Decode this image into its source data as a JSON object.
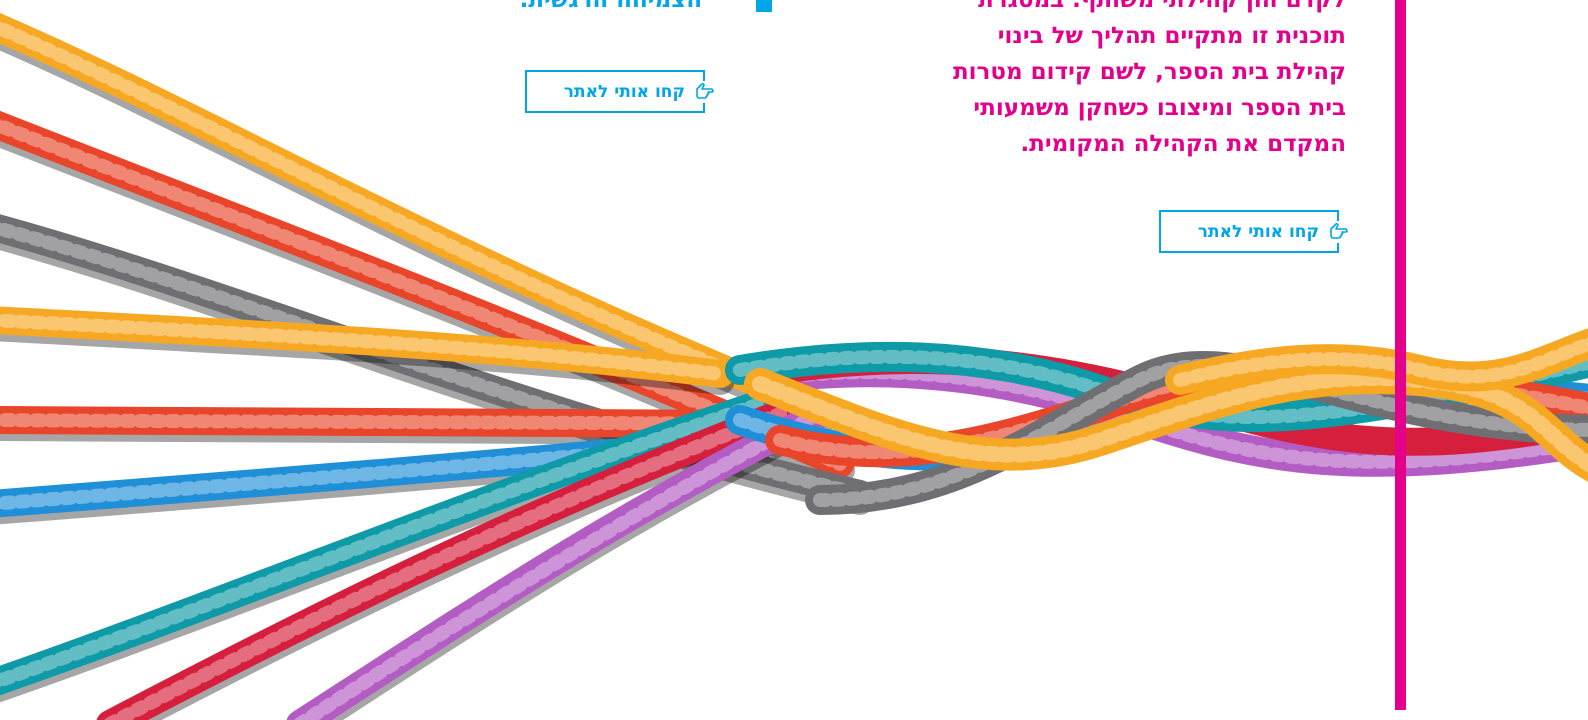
{
  "main": {
    "right_column": {
      "lines": [
        "לקדם הון קהילתי משותף. במסגרת",
        "תוכנית זו מתקיים תהליך של בינוי",
        "קהילת בית הספר, לשם קידום מטרות",
        "בית הספר ומיצובו כשחקן משמעותי",
        "המקדם את הקהילה המקומית."
      ]
    },
    "mid_column": {
      "line": "הצמיחה הרגשית."
    },
    "links": [
      {
        "label": "קחו אותי לאתר",
        "icon": "pointing-hand-icon"
      },
      {
        "label": "קחו אותי לאתר",
        "icon": "pointing-hand-icon"
      }
    ]
  },
  "colors": {
    "accent_magenta": "#e5008c",
    "accent_cyan": "#00a6e8"
  },
  "illustration": {
    "subject": "braided-colorful-ropes",
    "rope_colors": [
      "#f7a823",
      "#e8452a",
      "#6f6f73",
      "#1f8fd8",
      "#0e9aa6",
      "#d61f3c",
      "#b35cc4"
    ]
  }
}
